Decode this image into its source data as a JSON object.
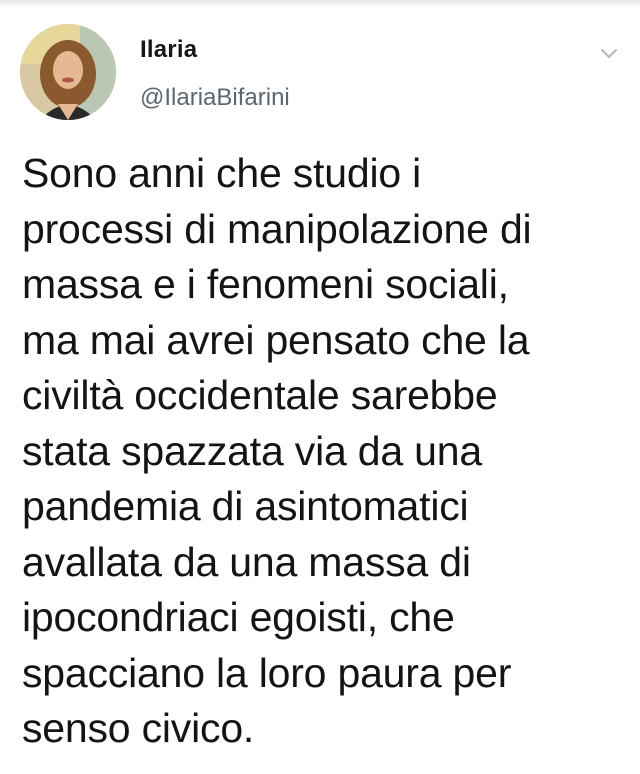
{
  "tweet": {
    "author_name": "Ilaria",
    "author_handle": "@IlariaBifarini",
    "text": "Sono anni che studio i\nprocessi di manipolazione di\nmassa e i fenomeni sociali,\nma mai avrei pensato che la\nciviltà occidentale sarebbe\nstata spazzata via da una\npandemia di asintomatici\navallata da una massa di\nipocondriaci egoisti, che\nspacciano la loro paura per\nsenso civico."
  },
  "icons": {
    "avatar": "profile-photo",
    "menu": "chevron-down-icon"
  },
  "colors": {
    "name": "#14171a",
    "handle": "#5b6770",
    "text": "#141414",
    "chevron": "#aab8c2"
  }
}
